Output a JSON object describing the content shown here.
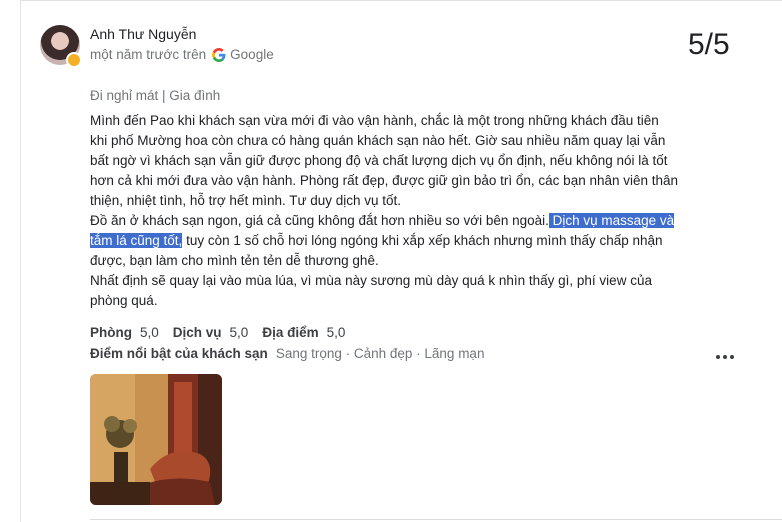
{
  "review": {
    "reviewer_name": "Anh Thư Nguyễn",
    "time_ago": "một năm trước trên",
    "source": "Google",
    "score": "5/5",
    "trip_type": "Đi nghỉ mát | Gia đình",
    "text": {
      "line_a": "Mình đến Pao khi khách sạn vừa mới đi vào vận hành, chắc là một trong những khách đầu tiên",
      "line_b": "khi phố Mường hoa còn chưa có hàng quán khách sạn nào hết. Giờ sau nhiều năm quay lại vẫn",
      "line_c": "bất ngờ vì khách sạn vẫn giữ được phong độ và chất lượng dịch vụ ổn định, nếu không nói là tốt",
      "line_d": "hơn cả khi mới đưa vào vận hành. Phòng rất đẹp, được giữ gìn bảo trì ổn, các bạn nhân viên thân",
      "line_e": "thiện, nhiệt tình, hỗ trợ hết mình. Tư duy dịch vụ tốt.",
      "line_f_pre": "Đồ ăn ở khách sạn ngon, giá cả cũng không đắt hơn nhiều so với bên ngoài.",
      "line_f_hl": " Dịch vụ massage và",
      "line_g_hl": "tắm lá cũng tốt,",
      "line_g_post": " tuy còn 1 số chỗ hơi lóng ngóng khi xắp xếp khách nhưng mình thấy chấp nhận",
      "line_h": "được, bạn làm cho mình tẻn tẻn dễ thương ghê.",
      "line_i": "Nhất định sẽ quay lại vào mùa lúa, vì mùa này sương mù dày quá k nhìn thấy gì, phí view của",
      "line_j": "phòng quá."
    },
    "ratings": [
      {
        "label": "Phòng",
        "value": "5,0"
      },
      {
        "label": "Dịch vụ",
        "value": "5,0"
      },
      {
        "label": "Địa điểm",
        "value": "5,0"
      }
    ],
    "highlights_label": "Điểm nổi bật của khách sạn",
    "highlights_values": "Sang trọng · Cảnh đẹp · Lãng mạn"
  },
  "colors": {
    "highlight": "#3f6dcd",
    "muted_text": "#70757a"
  }
}
